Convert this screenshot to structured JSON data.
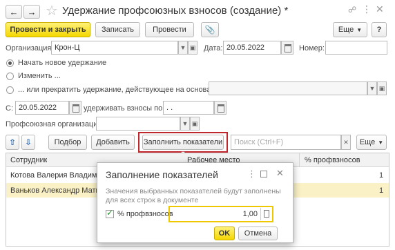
{
  "window": {
    "title": "Удержание профсоюзных взносов (создание) *"
  },
  "toolbar": {
    "post_close": "Провести и закрыть",
    "save": "Записать",
    "post": "Провести",
    "more": "Еще",
    "help": "?"
  },
  "form": {
    "org_label": "Организация:",
    "org_value": "Крон-Ц",
    "date_label": "Дата:",
    "date_value": "20.05.2022",
    "number_label": "Номер:",
    "number_value": "",
    "radio_start": "Начать новое удержание",
    "radio_change": "Изменить ...",
    "radio_stop": "... или прекратить удержание, действующее на основании",
    "from_label": "С:",
    "from_value": "20.05.2022",
    "until_label": "удерживать взносы по:",
    "until_value": " .  .",
    "union_label": "Профсоюзная организация:",
    "union_value": ""
  },
  "table_toolbar": {
    "select": "Подбор",
    "add": "Добавить",
    "fill": "Заполнить показатели",
    "search_placeholder": "Поиск (Ctrl+F)",
    "more": "Еще"
  },
  "table": {
    "columns": [
      "Сотрудник",
      "Рабочее место",
      "% профвзносов"
    ],
    "rows": [
      {
        "employee": "Котова Валерия Владимир",
        "workplace": "",
        "percent": "1"
      },
      {
        "employee": "Ваньков Александр Матве",
        "workplace": "",
        "percent": "1"
      }
    ]
  },
  "dialog": {
    "title": "Заполнение показателей",
    "description": "Значения выбранных показателей будут заполнены для всех строк в документе",
    "checkbox_label": "% профвзносов",
    "value": "1,00",
    "ok": "OK",
    "cancel": "Отмена"
  },
  "colors": {
    "accent_yellow": "#f4d700",
    "highlight_red": "#c0272d",
    "selected_row": "#fbf1c6"
  }
}
